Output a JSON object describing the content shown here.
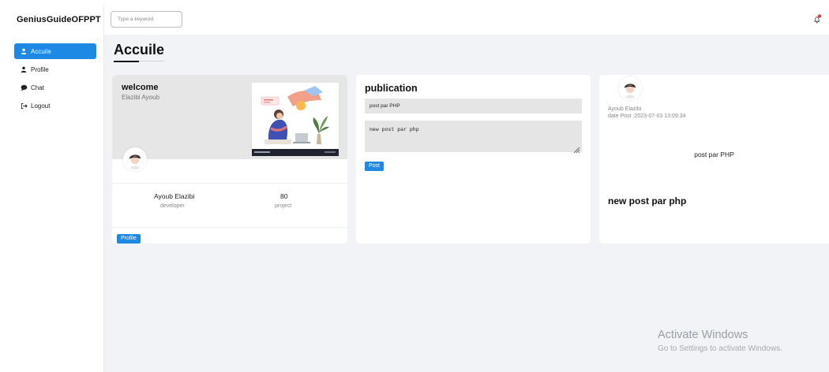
{
  "app": {
    "brand": "GeniusGuideOFPPT"
  },
  "sidebar": {
    "items": [
      {
        "label": "Accuile",
        "icon": "user-icon",
        "active": true
      },
      {
        "label": "Profile",
        "icon": "user-icon",
        "active": false
      },
      {
        "label": "Chat",
        "icon": "chat-icon",
        "active": false
      },
      {
        "label": "Logout",
        "icon": "logout-icon",
        "active": false
      }
    ]
  },
  "topbar": {
    "search_placeholder": "Type a keyword",
    "notification_icon": "bell-icon"
  },
  "main": {
    "title": "Accuile",
    "profile_card": {
      "greeting": "welcome",
      "subtitle": "Elazibi Ayoub",
      "name": "Ayoub Elazibi",
      "role": "developer",
      "project_count": "80",
      "project_label": "project",
      "button_label": "Profile"
    },
    "publication_card": {
      "title": "publication",
      "title_value": "post par PHP",
      "body_value": "new post par php",
      "button_label": "Post"
    },
    "post_card": {
      "author": "Ayoub Elazibi",
      "date": "date Post :2023-07-03 13:09:34",
      "subject": "post par PHP",
      "body": "new post par php"
    }
  },
  "watermark": {
    "title": "Activate Windows",
    "subtitle": "Go to Settings to activate Windows."
  },
  "colors": {
    "accent": "#1e88e5",
    "background": "#f1f3f6",
    "card_header": "#e6e6e6",
    "notification_dot": "#e53935"
  }
}
